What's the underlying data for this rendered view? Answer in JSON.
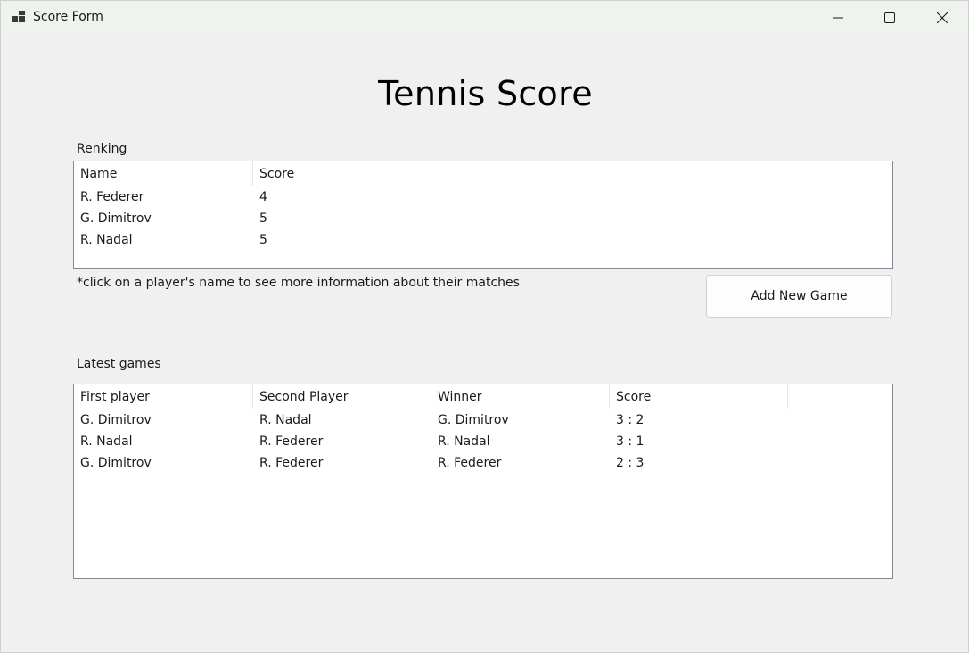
{
  "window": {
    "title": "Score Form",
    "controls": [
      "minimize-icon",
      "maximize-icon",
      "close-icon"
    ]
  },
  "heading": "Tennis Score",
  "ranking": {
    "label": "Renking",
    "columns": [
      "Name",
      "Score"
    ],
    "rows": [
      [
        "R. Federer",
        "4"
      ],
      [
        "G. Dimitrov",
        "5"
      ],
      [
        "R. Nadal",
        "5"
      ]
    ]
  },
  "hint": "*click on a player's name to see more information about their matches",
  "add_button": "Add New Game",
  "latest": {
    "label": "Latest games",
    "columns": [
      "First player",
      "Second Player",
      "Winner",
      "Score"
    ],
    "rows": [
      [
        "G. Dimitrov",
        "R. Nadal",
        "G. Dimitrov",
        "3 : 2"
      ],
      [
        "R. Nadal",
        "R. Federer",
        "R. Nadal",
        "3 : 1"
      ],
      [
        "G. Dimitrov",
        "R. Federer",
        "R. Federer",
        "2 : 3"
      ]
    ]
  }
}
